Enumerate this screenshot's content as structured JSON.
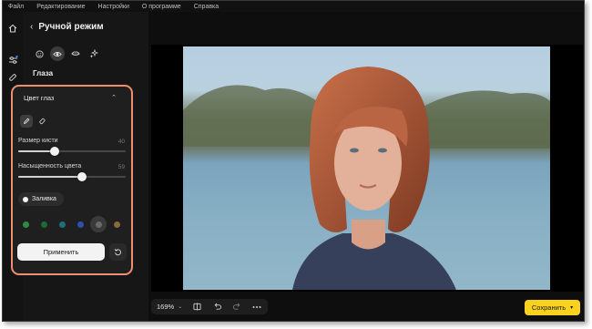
{
  "menubar": {
    "items": [
      "Файл",
      "Редактирование",
      "Настройки",
      "О программе",
      "Справка"
    ]
  },
  "header": {
    "back_icon": "chevron-left-icon",
    "title": "Ручной режим"
  },
  "rail": {
    "icons": [
      "home-icon",
      "sliders-icon",
      "bandage-icon"
    ]
  },
  "tool_tabs": {
    "items": [
      "face-icon",
      "eye-icon",
      "lips-icon",
      "sparkles-icon"
    ],
    "active": "eye-icon"
  },
  "section": {
    "title": "Глаза"
  },
  "eye_color": {
    "title": "Цвет глаз",
    "collapse_icon": "chevron-up-icon",
    "tools": [
      "pencil-icon",
      "eraser-icon"
    ],
    "brush_size": {
      "label": "Размер кисти",
      "value": "40",
      "fraction": 0.34
    },
    "saturation": {
      "label": "Насыщенность цвета",
      "value": "59",
      "fraction": 0.59
    },
    "fill_toggle": {
      "label": "Заливка"
    },
    "swatches": [
      "#2f8a47",
      "#1f6b33",
      "#1f6f78",
      "#2f4fa8",
      "#6a6a6a",
      "#8a6a3a"
    ],
    "selected_swatch": 4,
    "apply_label": "Применить",
    "reset_icon": "reset-icon"
  },
  "bottom_bar": {
    "zoom": "169%",
    "icons": [
      "compare-icon",
      "undo-icon",
      "redo-icon",
      "more-icon"
    ]
  },
  "save": {
    "label": "Сохранить"
  },
  "colors": {
    "accent": "#f8d21e",
    "highlight": "#ee8d6f"
  }
}
